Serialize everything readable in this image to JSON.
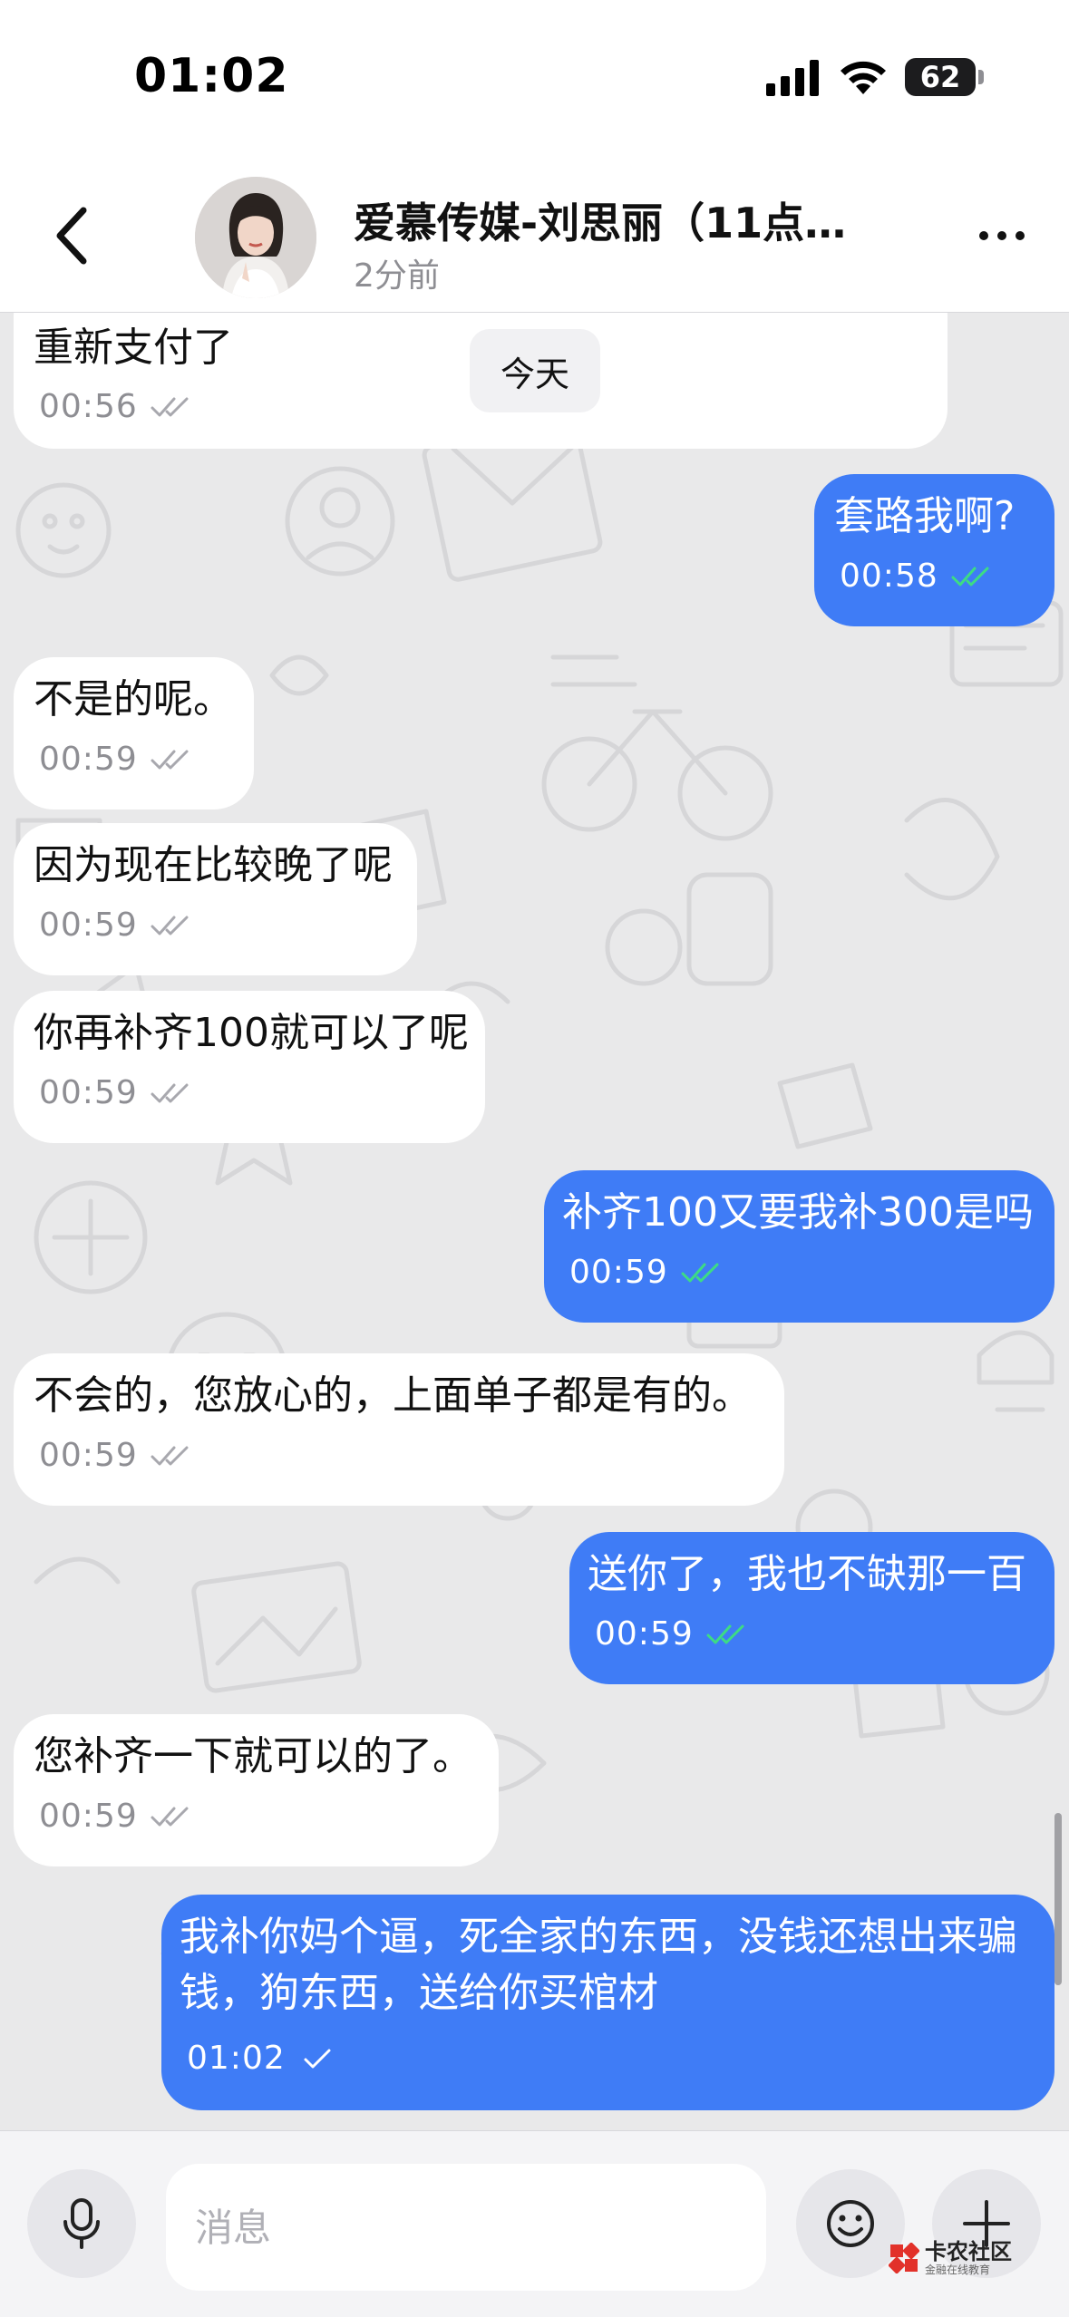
{
  "status_bar": {
    "time": "01:02",
    "battery": "62"
  },
  "header": {
    "title": "爱慕传媒-刘思丽（11点准…",
    "subtitle": "2分前"
  },
  "chat": {
    "date_separator": "今天",
    "messages": [
      {
        "direction": "in",
        "text": "重新支付了",
        "time": "00:56",
        "status": "read"
      },
      {
        "direction": "out",
        "text": "套路我啊?",
        "time": "00:58",
        "status": "read"
      },
      {
        "direction": "in",
        "text": "不是的呢。",
        "time": "00:59",
        "status": "read"
      },
      {
        "direction": "in",
        "text": "因为现在比较晚了呢",
        "time": "00:59",
        "status": "read"
      },
      {
        "direction": "in",
        "text": "你再补齐100就可以了呢",
        "time": "00:59",
        "status": "read"
      },
      {
        "direction": "out",
        "text": "补齐100又要我补300是吗",
        "time": "00:59",
        "status": "read"
      },
      {
        "direction": "in",
        "text": "不会的，您放心的，上面单子都是有的。",
        "time": "00:59",
        "status": "read"
      },
      {
        "direction": "out",
        "text": "送你了，我也不缺那一百",
        "time": "00:59",
        "status": "read"
      },
      {
        "direction": "in",
        "text": "您补齐一下就可以的了。",
        "time": "00:59",
        "status": "read"
      },
      {
        "direction": "out",
        "text_lines": [
          "我补你妈个逼，死全家的东西，没钱还想出来骗",
          "钱，狗东西，送给你买棺材"
        ],
        "time": "01:02",
        "status": "sent"
      }
    ]
  },
  "input": {
    "placeholder": "消息"
  },
  "watermark": {
    "title": "卡农社区",
    "subtitle": "金融在线教育"
  },
  "colors": {
    "outgoing_bubble": "#3f7cf6",
    "incoming_bubble": "#ffffff",
    "read_check_outgoing": "#3ddc84",
    "check_incoming": "#a8a8ae"
  }
}
